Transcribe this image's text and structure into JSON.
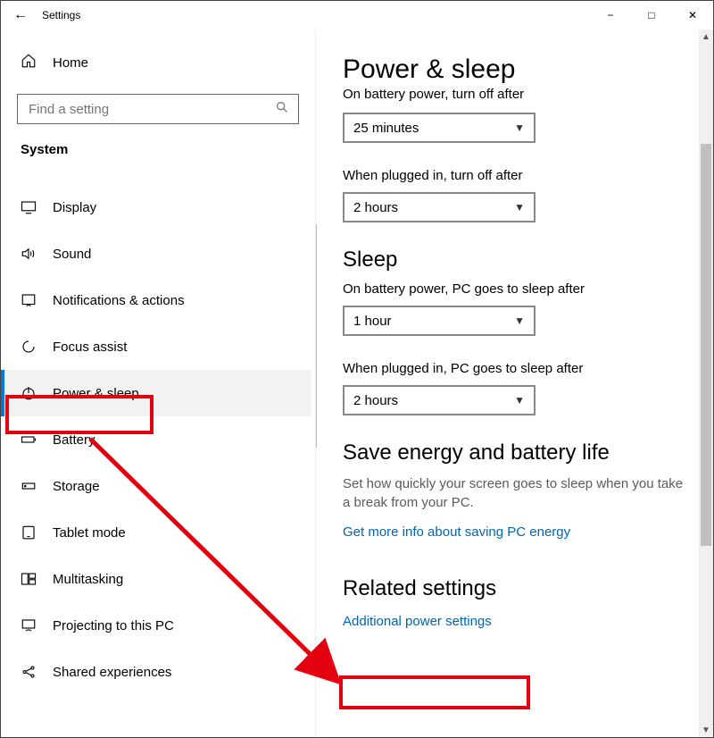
{
  "window": {
    "title": "Settings",
    "home_label": "Home",
    "search_placeholder": "Find a setting",
    "section": "System"
  },
  "sidebar": {
    "items": [
      {
        "id": "display",
        "label": "Display"
      },
      {
        "id": "sound",
        "label": "Sound"
      },
      {
        "id": "notifications",
        "label": "Notifications & actions"
      },
      {
        "id": "focus",
        "label": "Focus assist"
      },
      {
        "id": "power",
        "label": "Power & sleep",
        "selected": true
      },
      {
        "id": "battery",
        "label": "Battery"
      },
      {
        "id": "storage",
        "label": "Storage"
      },
      {
        "id": "tablet",
        "label": "Tablet mode"
      },
      {
        "id": "multitask",
        "label": "Multitasking"
      },
      {
        "id": "projecting",
        "label": "Projecting to this PC"
      },
      {
        "id": "shared",
        "label": "Shared experiences"
      }
    ]
  },
  "main": {
    "title": "Power & sleep",
    "screen": {
      "battery_label": "On battery power, turn off after",
      "battery_value": "25 minutes",
      "plugged_label": "When plugged in, turn off after",
      "plugged_value": "2 hours"
    },
    "sleep": {
      "heading": "Sleep",
      "battery_label": "On battery power, PC goes to sleep after",
      "battery_value": "1 hour",
      "plugged_label": "When plugged in, PC goes to sleep after",
      "plugged_value": "2 hours"
    },
    "energy": {
      "heading": "Save energy and battery life",
      "desc": "Set how quickly your screen goes to sleep when you take a break from your PC.",
      "link": "Get more info about saving PC energy"
    },
    "related": {
      "heading": "Related settings",
      "link": "Additional power settings"
    }
  }
}
